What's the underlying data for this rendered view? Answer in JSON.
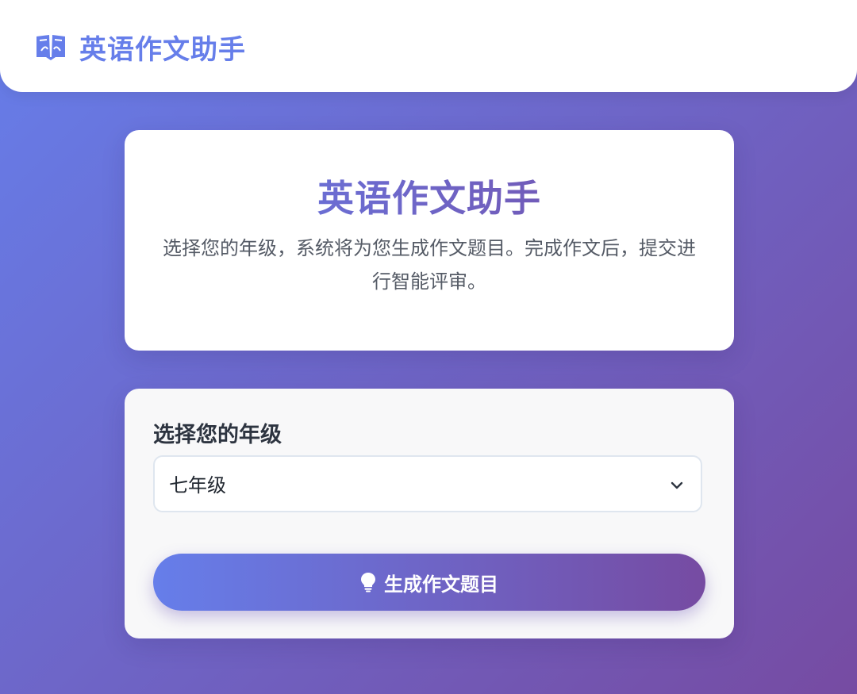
{
  "header": {
    "logo_icon": "book-open-icon",
    "title": "英语作文助手"
  },
  "hero": {
    "title": "英语作文助手",
    "description": "选择您的年级，系统将为您生成作文题目。完成作文后，提交进行智能评审。"
  },
  "form": {
    "grade_label": "选择您的年级",
    "grade_selected": "七年级",
    "dropdown_icon": "chevron-down-icon",
    "generate_button_label": "生成作文题目",
    "generate_button_icon": "lightbulb-icon"
  },
  "colors": {
    "gradient_start": "#667eea",
    "gradient_end": "#764ba2",
    "card_bg": "#ffffff",
    "text_dark": "#2d3440"
  }
}
